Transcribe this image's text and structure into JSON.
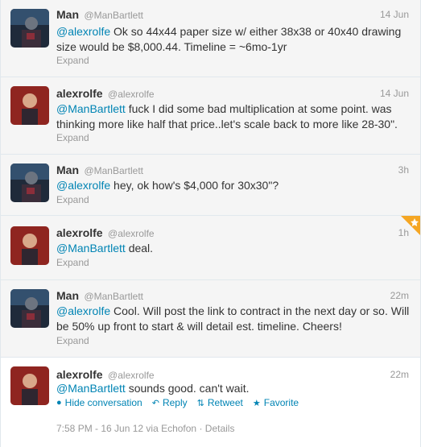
{
  "tweets": [
    {
      "fullname": "Man",
      "screenname": "@ManBartlett",
      "time": "14 Jun",
      "mention": "@alexrolfe",
      "body": " Ok so 44x44 paper size w/ either 38x38 or 40x40 drawing size would be $8,000.44. Timeline = ~6mo-1yr",
      "expand": "Expand"
    },
    {
      "fullname": "alexrolfe",
      "screenname": "@alexrolfe",
      "time": "14 Jun",
      "mention": "@ManBartlett",
      "body": " fuck I did some bad multiplication at some point. was thinking more like half that price..let's scale back to more like 28-30\".",
      "expand": "Expand"
    },
    {
      "fullname": "Man",
      "screenname": "@ManBartlett",
      "time": "3h",
      "mention": "@alexrolfe",
      "body": " hey, ok how's $4,000 for 30x30\"?",
      "expand": "Expand"
    },
    {
      "fullname": "alexrolfe",
      "screenname": "@alexrolfe",
      "time": "1h",
      "mention": "@ManBartlett",
      "body": " deal.",
      "expand": "Expand"
    },
    {
      "fullname": "Man",
      "screenname": "@ManBartlett",
      "time": "22m",
      "mention": "@alexrolfe",
      "body": " Cool. Will post the link to contract in the next day or so. Will be 50% up front to start & will detail est. timeline. Cheers!",
      "expand": "Expand"
    },
    {
      "fullname": "alexrolfe",
      "screenname": "@alexrolfe",
      "time": "22m",
      "mention": "@ManBartlett",
      "body": " sounds good. can't wait."
    }
  ],
  "actions": {
    "hide_conversation": "Hide conversation",
    "reply": "Reply",
    "retweet": "Retweet",
    "favorite": "Favorite"
  },
  "meta": {
    "timestamp": "7:58 PM - 16 Jun 12 via Echofon",
    "details": "Details"
  },
  "colors": {
    "link": "#0084b4",
    "text": "#333333",
    "muted": "#999999",
    "favorite_star": "#f5a623"
  }
}
